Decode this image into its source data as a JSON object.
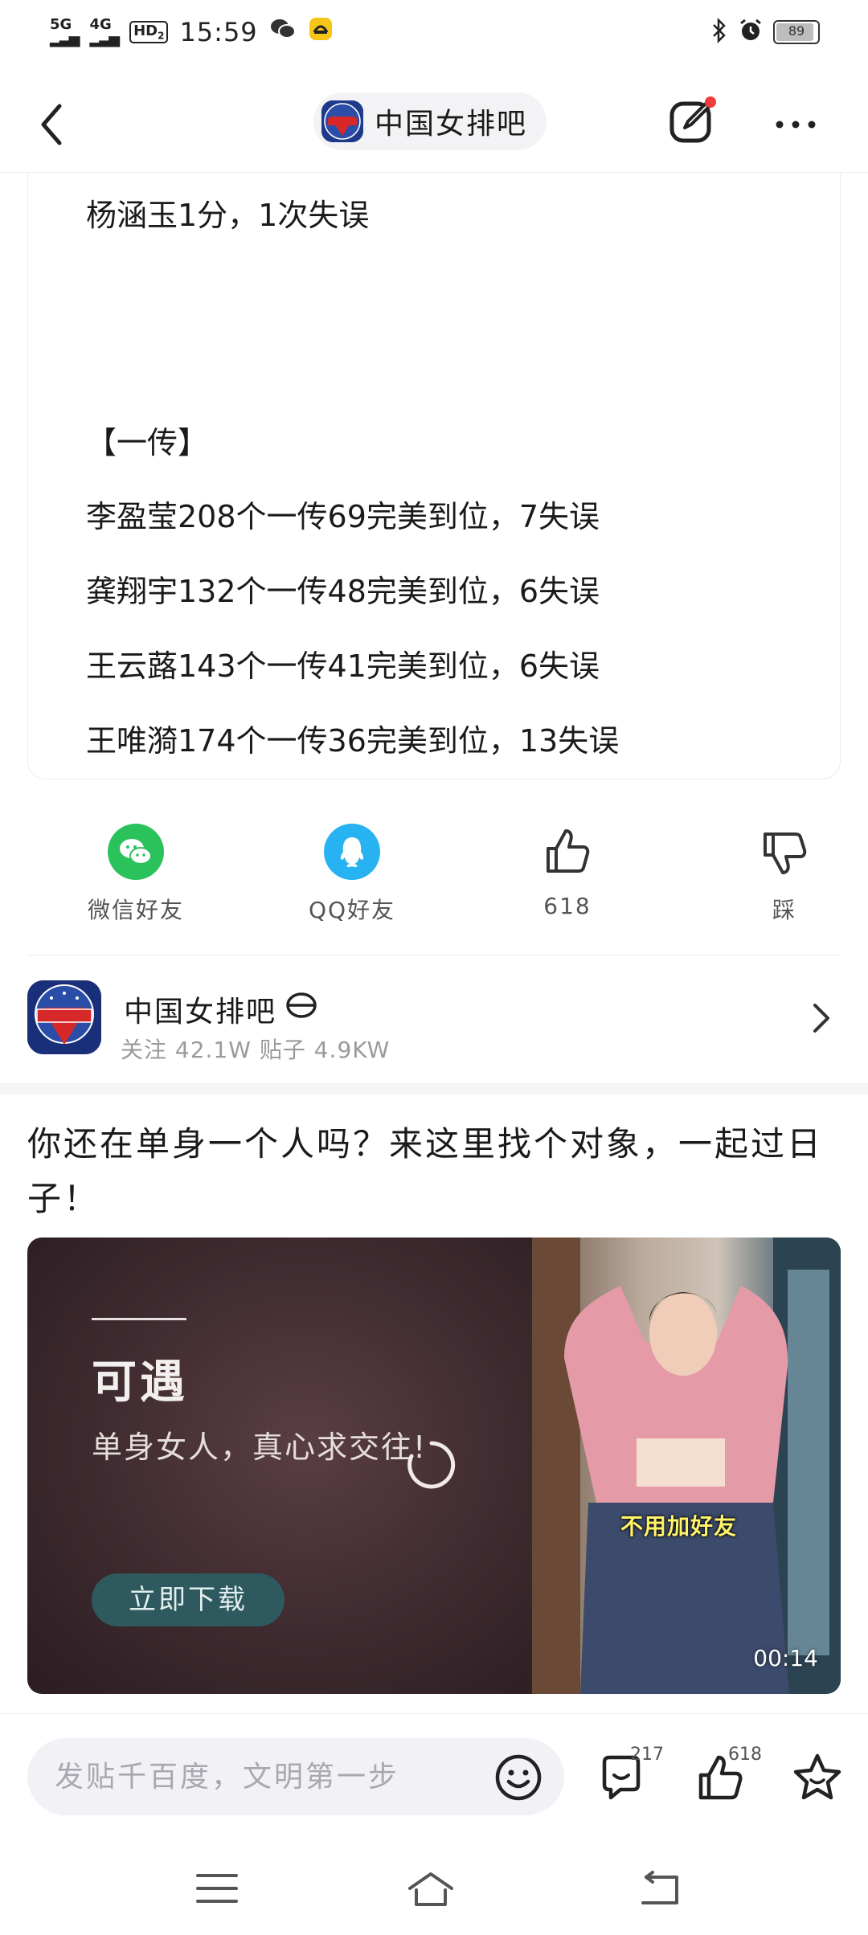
{
  "status_bar": {
    "signal1": "5G",
    "signal2": "4G",
    "hd_label": "HD",
    "hd_sub": "2",
    "time": "15:59",
    "battery": "89"
  },
  "header": {
    "forum_name": "中国女排吧"
  },
  "post": {
    "lines": [
      "杨涵玉1分，1次失误",
      "【一传】",
      "李盈莹208个一传69完美到位，7失误",
      "龚翔宇132个一传48完美到位，6失误",
      "王云蕗143个一传41完美到位，6失误",
      "王唯漪174个一传36完美到位，13失误"
    ]
  },
  "share": {
    "wechat_label": "微信好友",
    "qq_label": "QQ好友",
    "like_count": "618",
    "dislike_label": "踩",
    "wechat_color": "#2bc25c",
    "qq_color": "#27b2f2"
  },
  "forum_card": {
    "name": "中国女排吧",
    "stats": "关注 42.1W  贴子 4.9KW"
  },
  "ad": {
    "title": "你还在单身一个人吗？来这里找个对象，一起过日子！",
    "brand": "可遇",
    "slogan": "单身女人，真心求交往!",
    "download_label": "立即下载",
    "caption": "不用加好友",
    "duration": "00:14"
  },
  "bottom_bar": {
    "reply_placeholder": "发贴千百度，文明第一步",
    "comment_count": "217",
    "like_count": "618"
  },
  "icons": {
    "back": "back-icon",
    "edit": "edit-icon",
    "more": "more-icon",
    "emoji": "emoji-icon",
    "comment": "comment-icon",
    "like": "thumb-up-icon",
    "favorite": "star-icon",
    "dislike": "thumb-down-icon"
  }
}
